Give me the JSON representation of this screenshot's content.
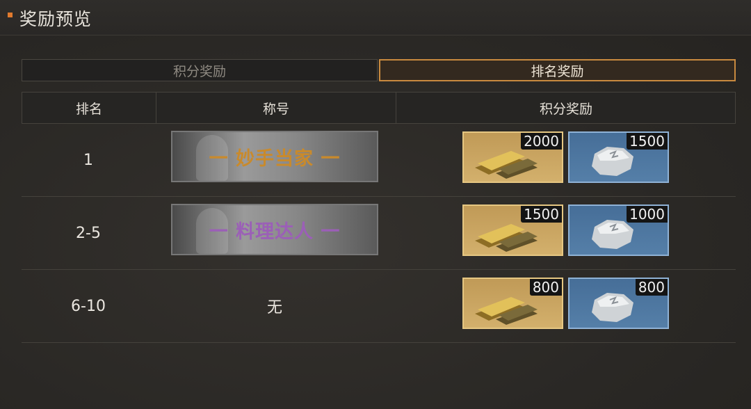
{
  "panel": {
    "title": "奖励预览",
    "accent": "#e07a2e"
  },
  "tabs": [
    {
      "label": "积分奖励",
      "selected": false
    },
    {
      "label": "排名奖励",
      "selected": true
    }
  ],
  "table": {
    "headers": [
      "排名",
      "称号",
      "积分奖励"
    ],
    "rows": [
      {
        "rank": "1",
        "title": "一 妙手当家 一",
        "title_color": "#c98a2c",
        "rewards": [
          {
            "icon": "gold-bars-icon",
            "count": "2000"
          },
          {
            "icon": "silver-stone-icon",
            "count": "1500"
          }
        ]
      },
      {
        "rank": "2-5",
        "title": "一 料理达人 一",
        "title_color": "#9b5fb7",
        "rewards": [
          {
            "icon": "gold-bars-icon",
            "count": "1500"
          },
          {
            "icon": "silver-stone-icon",
            "count": "1000"
          }
        ]
      },
      {
        "rank": "6-10",
        "title": "无",
        "title_color": "",
        "rewards": [
          {
            "icon": "gold-bars-icon",
            "count": "800"
          },
          {
            "icon": "silver-stone-icon",
            "count": "800"
          }
        ]
      }
    ]
  }
}
